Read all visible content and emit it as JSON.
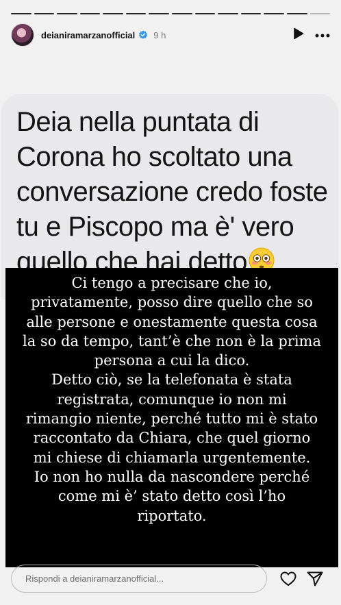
{
  "progress": {
    "segments": 14,
    "current_index": 13
  },
  "header": {
    "username": "deianiramarzanofficial",
    "time_ago": "9 h",
    "icons": [
      "verified-badge-icon",
      "play-icon",
      "more-icon"
    ]
  },
  "bubble": {
    "lines": [
      "Deia nella puntata di",
      "Corona ho scoltato una",
      "conversazione credo foste",
      "tu e Piscopo ma è' vero",
      "quello che hai detto"
    ],
    "emoji": "flushed-face-emoji"
  },
  "overlay": {
    "lines": [
      "Ci tengo a precisare che io,",
      "privatamente, posso dire quello che so",
      "alle persone e onestamente questa cosa",
      "la so da tempo, tant’è che non è la prima",
      "persona a cui la dico.",
      "Detto ciò, se la telefonata è stata",
      "registrata, comunque io non mi",
      "rimangio niente, perché tutto mi è stato",
      "raccontato da Chiara, che quel giorno",
      "mi chiese di chiamarla urgentemente.",
      "Io non ho nulla da nascondere perché",
      "come mi è’ stato detto così l’ho",
      "riportato."
    ]
  },
  "footer": {
    "reply_placeholder": "Rispondi a deianiramarzanofficial...",
    "icons": [
      "heart-icon",
      "send-icon"
    ]
  },
  "colors": {
    "background": "#f1f1f1",
    "bubble": "#e9e9eb",
    "overlay": "#000000",
    "text_light": "#ffffff"
  }
}
